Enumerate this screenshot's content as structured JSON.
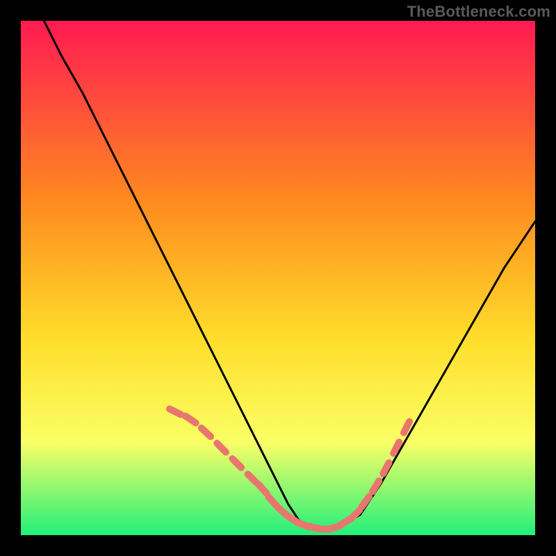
{
  "watermark": "TheBottleneck.com",
  "colors": {
    "page_bg": "#000000",
    "gradient_top": "#ff1a52",
    "gradient_mid1": "#ff8a1f",
    "gradient_mid2": "#ffde2b",
    "gradient_mid3": "#faff66",
    "gradient_bottom": "#22ef7a",
    "curve": "#000000",
    "marker": "#e9766e"
  },
  "chart_data": {
    "type": "line",
    "title": "",
    "xlabel": "",
    "ylabel": "",
    "xlim": [
      0,
      100
    ],
    "ylim": [
      0,
      100
    ],
    "grid": false,
    "curve": {
      "name": "bottleneck-curve",
      "x": [
        0,
        4,
        8,
        12,
        16,
        20,
        24,
        28,
        32,
        36,
        40,
        44,
        48,
        50,
        52,
        54,
        56,
        58,
        60,
        62,
        66,
        70,
        74,
        78,
        82,
        86,
        90,
        94,
        98,
        100
      ],
      "y": [
        108,
        101,
        93,
        86,
        78,
        70,
        62,
        54,
        46,
        38,
        30,
        22,
        14,
        10,
        6,
        3,
        1.5,
        1,
        1,
        1.5,
        4,
        10,
        17,
        24,
        31,
        38,
        45,
        52,
        58,
        61
      ]
    },
    "markers": {
      "name": "highlighted-points",
      "x": [
        30,
        33,
        36,
        39,
        42,
        45,
        47,
        49,
        51,
        53,
        55,
        57,
        59,
        61,
        63,
        65,
        67,
        69,
        71,
        73,
        75
      ],
      "y": [
        24,
        22.5,
        20,
        17,
        14,
        11,
        9,
        6.5,
        4.5,
        3,
        2,
        1.5,
        1.2,
        1.5,
        2.5,
        4,
        6.5,
        9.5,
        13,
        17,
        21
      ]
    }
  }
}
